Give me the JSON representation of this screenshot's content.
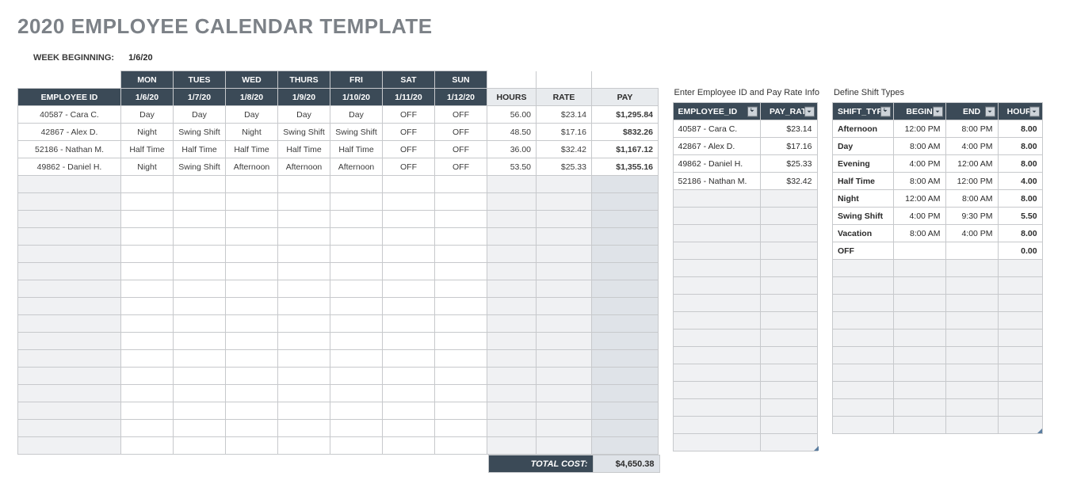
{
  "title": "2020 EMPLOYEE CALENDAR TEMPLATE",
  "week_label": "WEEK BEGINNING:",
  "week_value": "1/6/20",
  "schedule": {
    "days_of_week": [
      "MON",
      "TUES",
      "WED",
      "THURS",
      "FRI",
      "SAT",
      "SUN"
    ],
    "employee_id_header": "EMPLOYEE ID",
    "dates": [
      "1/6/20",
      "1/7/20",
      "1/8/20",
      "1/9/20",
      "1/10/20",
      "1/11/20",
      "1/12/20"
    ],
    "hours_header": "HOURS",
    "rate_header": "RATE",
    "pay_header": "PAY",
    "rows": [
      {
        "emp": "40587 - Cara C.",
        "shifts": [
          "Day",
          "Day",
          "Day",
          "Day",
          "Day",
          "OFF",
          "OFF"
        ],
        "hours": "56.00",
        "rate": "$23.14",
        "pay": "$1,295.84"
      },
      {
        "emp": "42867 - Alex D.",
        "shifts": [
          "Night",
          "Swing Shift",
          "Night",
          "Swing Shift",
          "Swing Shift",
          "OFF",
          "OFF"
        ],
        "hours": "48.50",
        "rate": "$17.16",
        "pay": "$832.26"
      },
      {
        "emp": "52186 - Nathan M.",
        "shifts": [
          "Half Time",
          "Half Time",
          "Half Time",
          "Half Time",
          "Half Time",
          "OFF",
          "OFF"
        ],
        "hours": "36.00",
        "rate": "$32.42",
        "pay": "$1,167.12"
      },
      {
        "emp": "49862 - Daniel H.",
        "shifts": [
          "Night",
          "Swing Shift",
          "Afternoon",
          "Afternoon",
          "Afternoon",
          "OFF",
          "OFF"
        ],
        "hours": "53.50",
        "rate": "$25.33",
        "pay": "$1,355.16"
      }
    ],
    "blank_rows": 16,
    "total_label": "TOTAL COST:",
    "total_value": "$4,650.38"
  },
  "employee_panel": {
    "caption": "Enter Employee ID and Pay Rate Info",
    "headers": [
      "EMPLOYEE_ID",
      "PAY_RATE"
    ],
    "rows": [
      {
        "id": "40587 - Cara C.",
        "rate": "$23.14"
      },
      {
        "id": "42867 - Alex D.",
        "rate": "$17.16"
      },
      {
        "id": "49862 - Daniel H.",
        "rate": "$25.33"
      },
      {
        "id": "52186 - Nathan M.",
        "rate": "$32.42"
      }
    ],
    "blank_rows": 15
  },
  "shift_panel": {
    "caption": "Define Shift Types",
    "headers": [
      "SHIFT_TYPE",
      "BEGIN",
      "END",
      "HOURS"
    ],
    "rows": [
      {
        "type": "Afternoon",
        "begin": "12:00 PM",
        "end": "8:00 PM",
        "hours": "8.00"
      },
      {
        "type": "Day",
        "begin": "8:00 AM",
        "end": "4:00 PM",
        "hours": "8.00"
      },
      {
        "type": "Evening",
        "begin": "4:00 PM",
        "end": "12:00 AM",
        "hours": "8.00"
      },
      {
        "type": "Half Time",
        "begin": "8:00 AM",
        "end": "12:00 PM",
        "hours": "4.00"
      },
      {
        "type": "Night",
        "begin": "12:00 AM",
        "end": "8:00 AM",
        "hours": "8.00"
      },
      {
        "type": "Swing Shift",
        "begin": "4:00 PM",
        "end": "9:30 PM",
        "hours": "5.50"
      },
      {
        "type": "Vacation",
        "begin": "8:00 AM",
        "end": "4:00 PM",
        "hours": "8.00"
      },
      {
        "type": "OFF",
        "begin": "",
        "end": "",
        "hours": "0.00"
      }
    ],
    "blank_rows": 10
  }
}
